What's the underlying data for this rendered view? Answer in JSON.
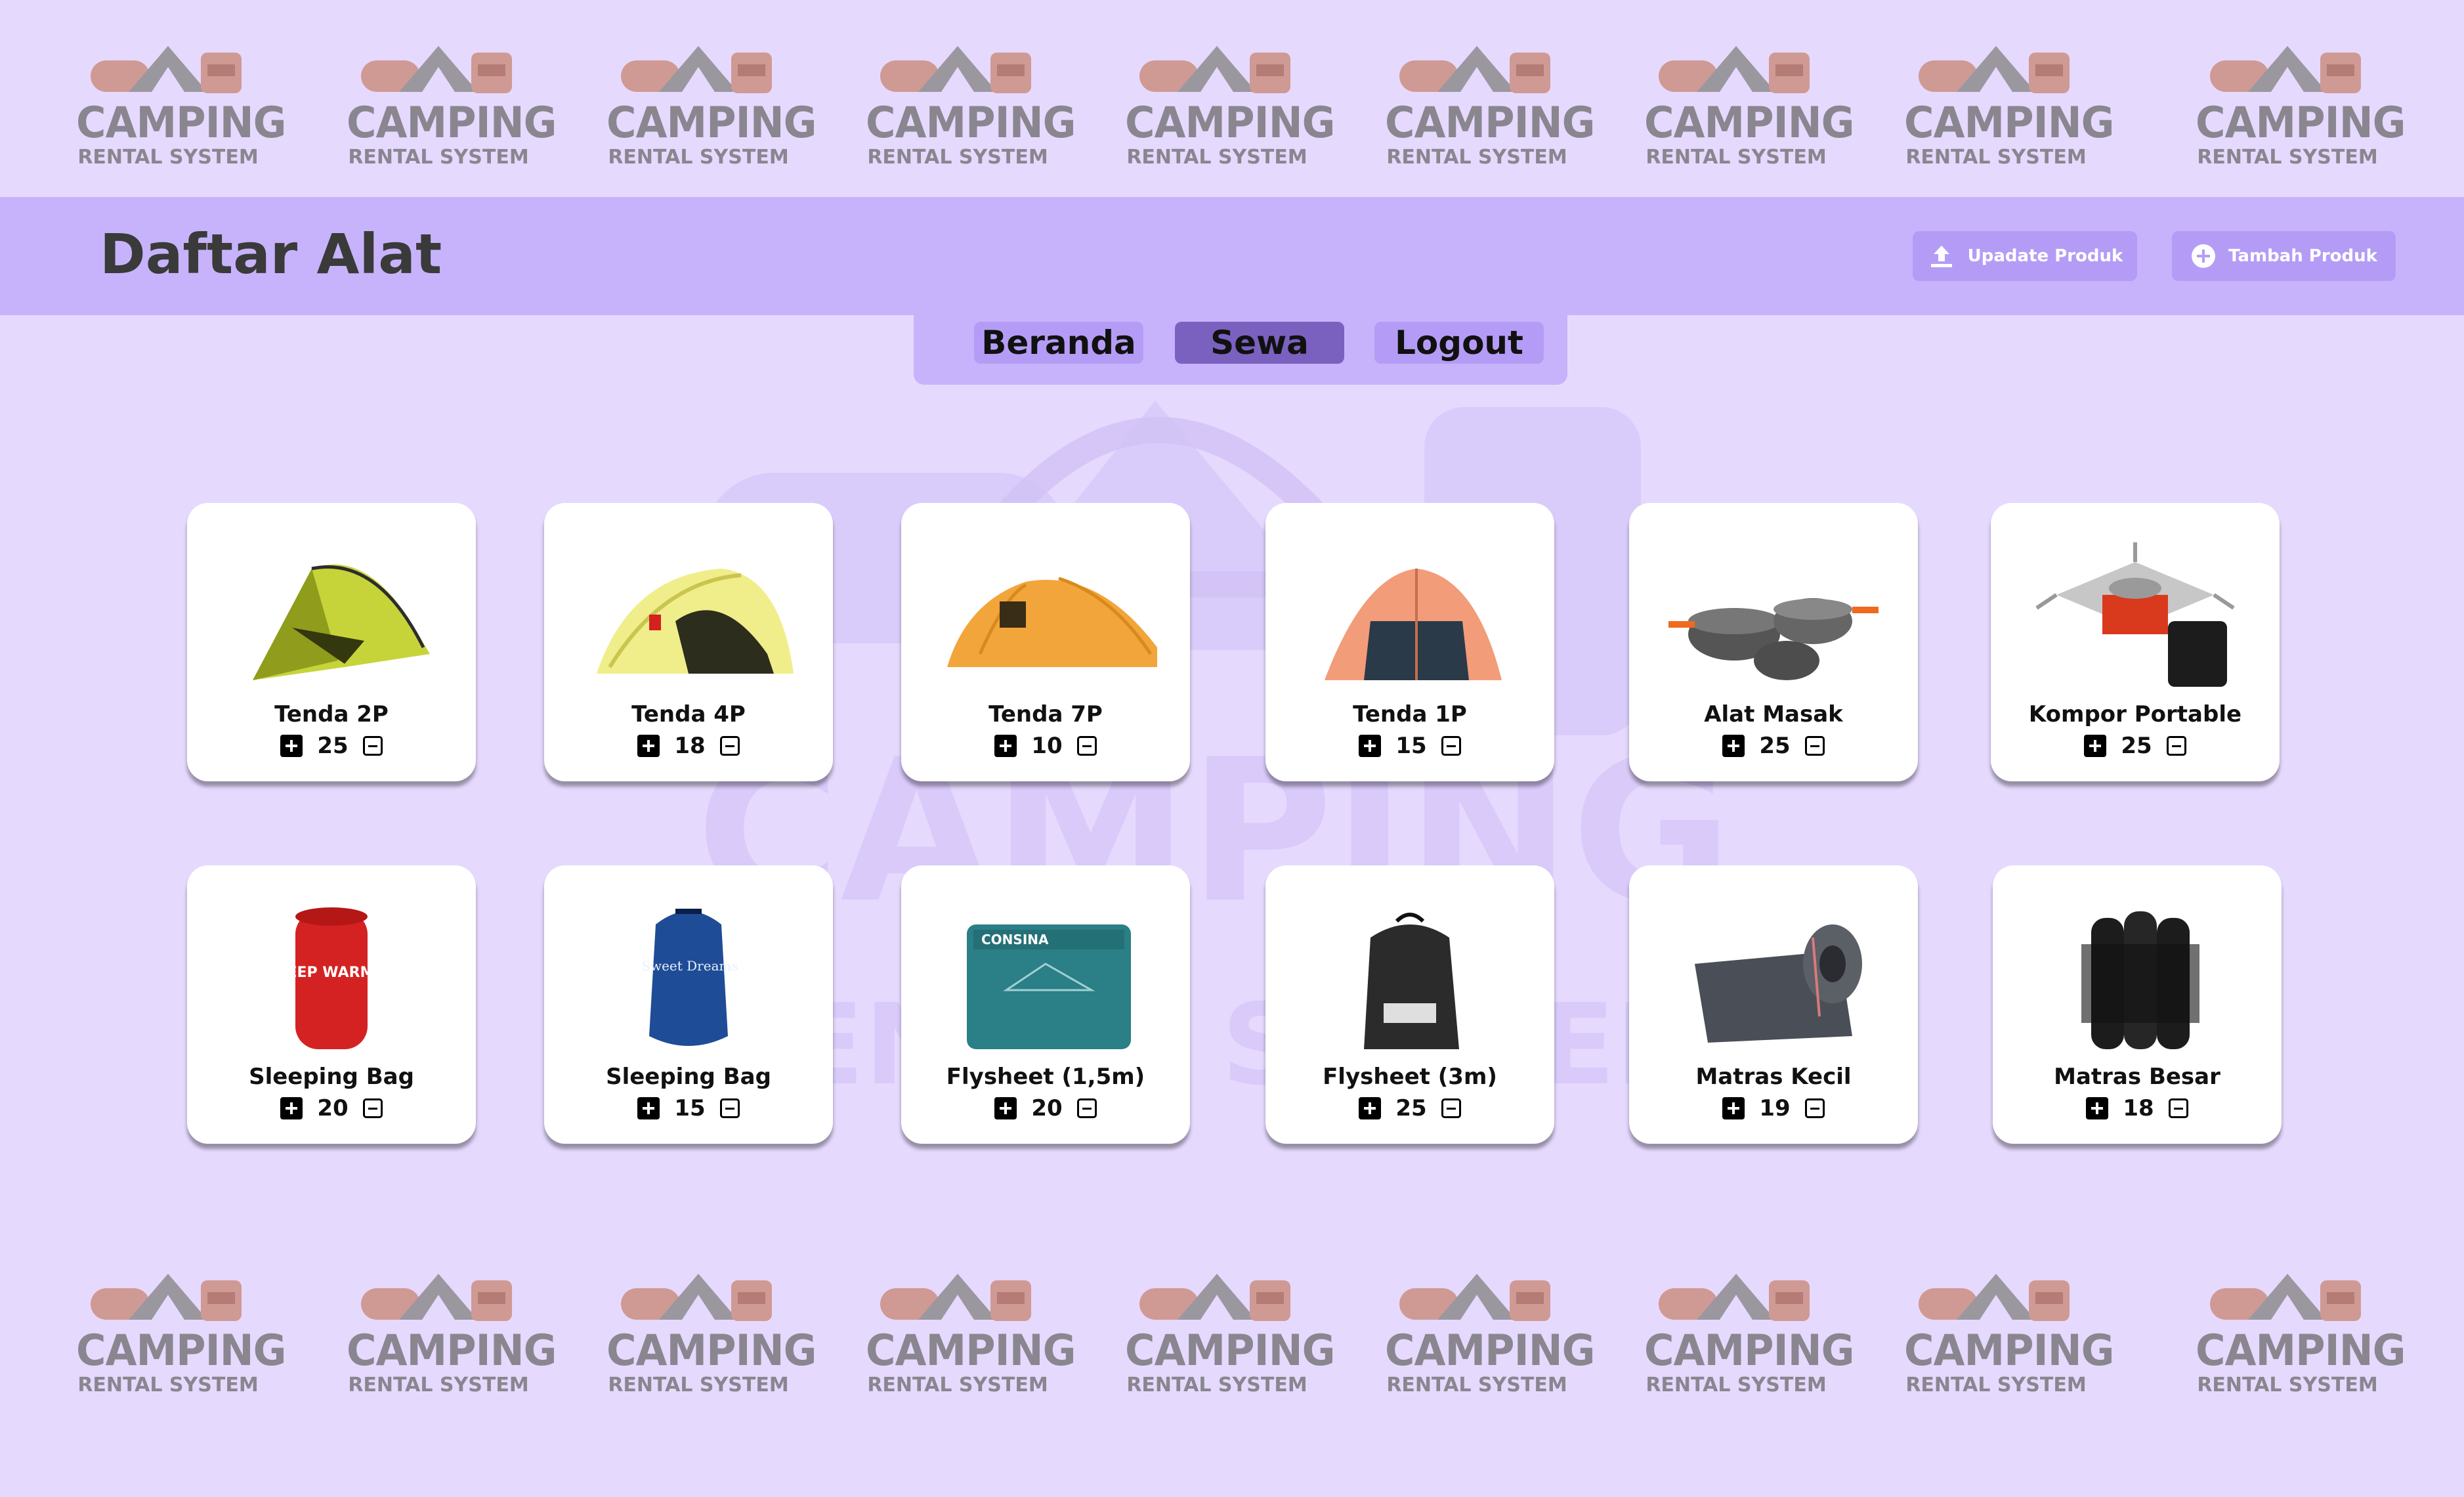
{
  "logo": {
    "line1": "CAMPING",
    "line2": "RENTAL SYSTEM"
  },
  "header": {
    "title": "Daftar Alat",
    "update_label": "Upadate Produk",
    "add_label": "Tambah Produk"
  },
  "nav": {
    "beranda": "Beranda",
    "sewa": "Sewa",
    "logout": "Logout",
    "active": "Sewa"
  },
  "products": [
    {
      "name": "Tenda 2P",
      "count": "25",
      "icon": "tent-2p-image"
    },
    {
      "name": "Tenda 4P",
      "count": "18",
      "icon": "tent-4p-image"
    },
    {
      "name": "Tenda 7P",
      "count": "10",
      "icon": "tent-7p-image"
    },
    {
      "name": "Tenda 1P",
      "count": "15",
      "icon": "tent-1p-image"
    },
    {
      "name": "Alat Masak",
      "count": "25",
      "icon": "cookware-image"
    },
    {
      "name": "Kompor Portable",
      "count": "25",
      "icon": "portable-stove-image"
    },
    {
      "name": "Sleeping Bag",
      "count": "20",
      "icon": "sleeping-bag-red-image"
    },
    {
      "name": "Sleeping Bag",
      "count": "15",
      "icon": "sleeping-bag-blue-image"
    },
    {
      "name": "Flysheet (1,5m)",
      "count": "20",
      "icon": "flysheet-small-image"
    },
    {
      "name": "Flysheet (3m)",
      "count": "25",
      "icon": "flysheet-large-image"
    },
    {
      "name": "Matras Kecil",
      "count": "19",
      "icon": "mat-small-image"
    },
    {
      "name": "Matras Besar",
      "count": "18",
      "icon": "mat-large-image"
    }
  ],
  "product_image_text": {
    "sleeping_bag_red": "SLEEP WARMER",
    "sleeping_bag_blue": "Sweet Dreams",
    "flysheet_brand": "CONSINA"
  },
  "colors": {
    "background": "#e6d9fe",
    "header": "#c7b3fb",
    "button": "#b49cf6",
    "active_nav": "#7b61bf",
    "title_text": "#3a3a3a"
  }
}
